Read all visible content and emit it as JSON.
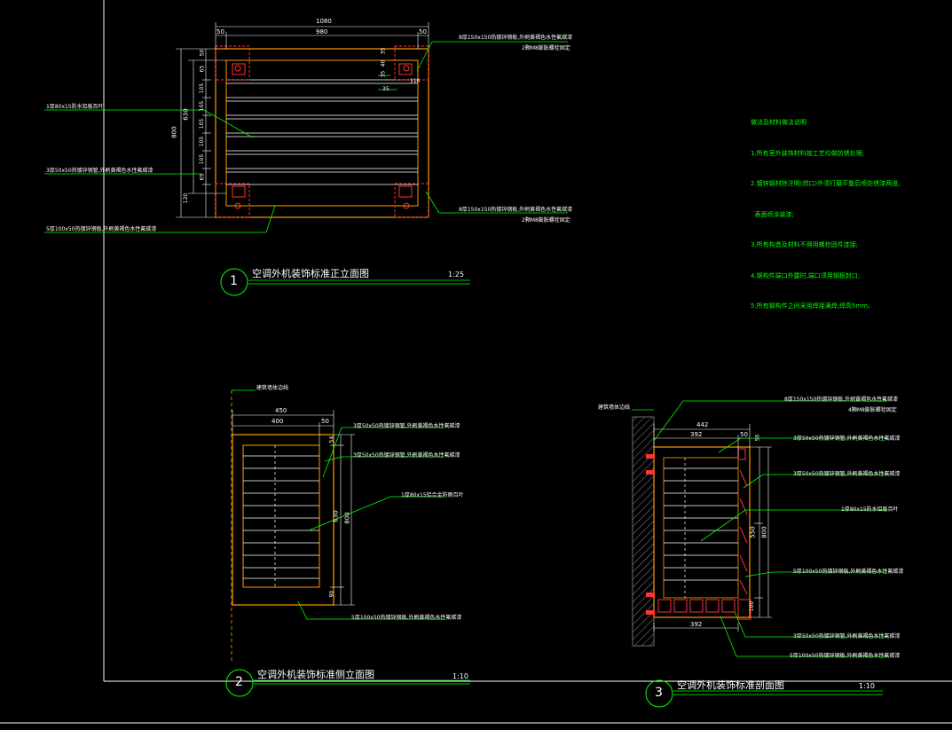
{
  "canvas": {
    "background": "#000000"
  },
  "colors": {
    "frame": "#ffffff",
    "dimension": "#ffffff",
    "object": "#ff9900",
    "steel": "#ff3333",
    "annotation": "#00ff00",
    "text": "#ffffff",
    "title": "#ffffff",
    "hatch": "#999999"
  },
  "notes": {
    "title": "做法及材料做法说明",
    "lines": [
      "1.所有室外装饰材料按工艺均做防锈处理;",
      "2.镀锌钢材除注明(焊口)外须打磨平整后喷防锈漆两道,",
      "  表面喷涂装漆;",
      "3.所有构造及材料不得用螺栓固件连接;",
      "4.钢构件端口外露时,端口须用钢板封口;",
      "5.所有钢构件之间采用焊接满焊,焊高5mm。"
    ]
  },
  "view1": {
    "number": "1",
    "title": "空调外机装饰标准正立面图",
    "scale": "1:25",
    "dim_top_total": "1080",
    "dim_top": [
      "50",
      "980",
      "50"
    ],
    "dim_left_total": "800",
    "dim_left_inner": "630",
    "dim_left_parts": [
      "50",
      "65",
      "105",
      "105",
      "105",
      "105",
      "105",
      "65",
      "120"
    ],
    "dim_small": [
      "35",
      "40",
      "35",
      "35",
      "110"
    ],
    "labels": [
      "8厚150x150热镀锌钢板,外刷黄褐色水性氟碳漆",
      "2颗M8膨胀螺栓固定",
      "1厚80x15防水铝板百叶",
      "3厚50x50热镀锌钢管,外刷黄褐色水性氟碳漆",
      "5厚100x50热镀锌钢板,外刷黄褐色水性氟碳漆",
      "8厚150x150热镀锌钢板,外刷黄褐色水性氟碳漆",
      "2颗M8膨胀螺栓固定"
    ]
  },
  "view2": {
    "number": "2",
    "title": "空调外机装饰标准侧立面图",
    "scale": "1:10",
    "wall_label": "建筑墙体边线",
    "dim_top_total": "450",
    "dim_top": [
      "400",
      "50"
    ],
    "dim_right_total": "800",
    "dim_right_inner": "630",
    "dim_right_parts": [
      "54",
      "90"
    ],
    "labels": [
      "3厚50x50热镀锌钢管,外刷黄褐色水性氟碳漆",
      "3厚50x50热镀锌钢管,外刷黄褐色水性氟碳漆",
      "1厚80x15铝合金防雨百叶",
      "5厚100x50热镀锌钢板,外刷黄褐色水性氟碳漆"
    ]
  },
  "view3": {
    "number": "3",
    "title": "空调外机装饰标准剖面图",
    "scale": "1:10",
    "wall_label": "建筑墙体边线",
    "dim_top_total": "442",
    "dim_top": [
      "392",
      "50"
    ],
    "dim_bottom": "392",
    "dim_right_total": "800",
    "dim_right_inner": "550",
    "dim_right_parts": [
      "50",
      "100"
    ],
    "labels": [
      "8厚150x150热镀锌钢板,外刷黄褐色水性氟碳漆",
      "4颗M8膨胀螺栓固定",
      "3厚50x50热镀锌钢管,外刷黄褐色水性氟碳漆",
      "3厚50x50热镀锌钢管,外刷黄褐色水性氟碳漆",
      "1厚80x15防水铝板百叶",
      "5厚100x50热镀锌钢板,外刷黄褐色水性氟碳漆",
      "3厚50x50热镀锌钢管,外刷黄褐色水性氟碳漆",
      "5厚100x50热镀锌钢板,外刷黄褐色水性氟碳漆"
    ]
  }
}
